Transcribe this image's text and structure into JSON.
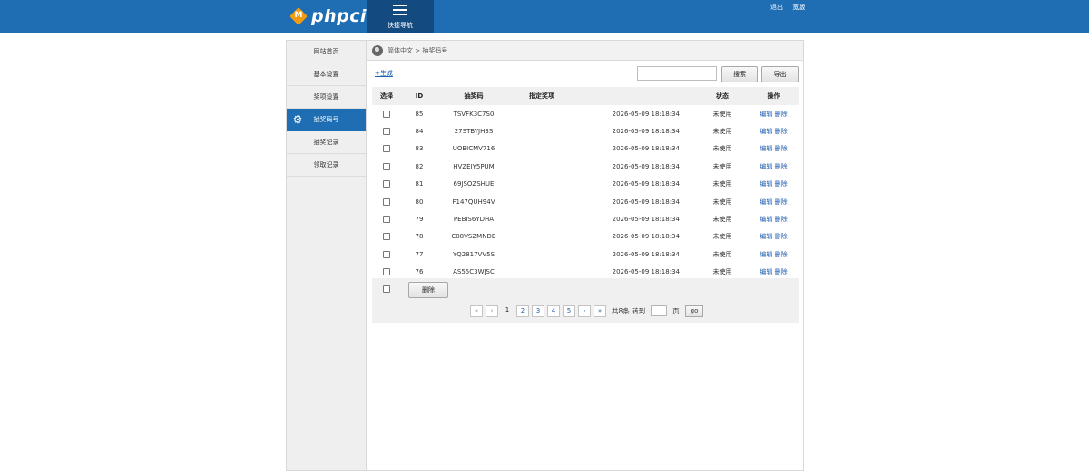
{
  "header": {
    "logo_text": "phpci",
    "logo_mark": "M",
    "quick_nav_label": "快捷导航",
    "links": [
      "退出",
      "宽版"
    ]
  },
  "sidebar": {
    "items": [
      {
        "label": "网站首页",
        "active": false
      },
      {
        "label": "基本设置",
        "active": false
      },
      {
        "label": "奖项设置",
        "active": false
      },
      {
        "label": "抽奖码号",
        "active": true
      },
      {
        "label": "抽奖记录",
        "active": false
      },
      {
        "label": "领取记录",
        "active": false
      }
    ]
  },
  "breadcrumb": "简体中文 > 抽奖码号",
  "toolbar": {
    "generate_link": "+生成",
    "search_value": "",
    "search_button": "搜索",
    "export_button": "导出"
  },
  "table": {
    "headers": [
      "选择",
      "ID",
      "抽奖码",
      "指定奖项",
      "",
      "状态",
      "操作"
    ],
    "rows": [
      {
        "id": "85",
        "code": "TSVFK3C7S0",
        "prize": "",
        "time": "2026-05-09 18:18:34",
        "status": "未使用",
        "edit": "编辑",
        "delete": "删除"
      },
      {
        "id": "84",
        "code": "27STBYJH3S",
        "prize": "",
        "time": "2026-05-09 18:18:34",
        "status": "未使用",
        "edit": "编辑",
        "delete": "删除"
      },
      {
        "id": "83",
        "code": "UOBICMV716",
        "prize": "",
        "time": "2026-05-09 18:18:34",
        "status": "未使用",
        "edit": "编辑",
        "delete": "删除"
      },
      {
        "id": "82",
        "code": "HVZEIY5PUM",
        "prize": "",
        "time": "2026-05-09 18:18:34",
        "status": "未使用",
        "edit": "编辑",
        "delete": "删除"
      },
      {
        "id": "81",
        "code": "69JSOZSHUE",
        "prize": "",
        "time": "2026-05-09 18:18:34",
        "status": "未使用",
        "edit": "编辑",
        "delete": "删除"
      },
      {
        "id": "80",
        "code": "F147QUH94V",
        "prize": "",
        "time": "2026-05-09 18:18:34",
        "status": "未使用",
        "edit": "编辑",
        "delete": "删除"
      },
      {
        "id": "79",
        "code": "PEBIS6YDHA",
        "prize": "",
        "time": "2026-05-09 18:18:34",
        "status": "未使用",
        "edit": "编辑",
        "delete": "删除"
      },
      {
        "id": "78",
        "code": "C08VSZMNDB",
        "prize": "",
        "time": "2026-05-09 18:18:34",
        "status": "未使用",
        "edit": "编辑",
        "delete": "删除"
      },
      {
        "id": "77",
        "code": "YQ2817VV5S",
        "prize": "",
        "time": "2026-05-09 18:18:34",
        "status": "未使用",
        "edit": "编辑",
        "delete": "删除"
      },
      {
        "id": "76",
        "code": "AS55C3WJSC",
        "prize": "",
        "time": "2026-05-09 18:18:34",
        "status": "未使用",
        "edit": "编辑",
        "delete": "删除"
      }
    ],
    "bulk_delete_button": "删除"
  },
  "pagination": {
    "first": "«",
    "prev": "‹",
    "current": "1",
    "pages": [
      "2",
      "3",
      "4",
      "5"
    ],
    "next": "›",
    "last": "»",
    "total_text": "共8条 转到",
    "page_unit": "页",
    "jump_value": "",
    "go_button": "go"
  },
  "colors": {
    "primary": "#1f6db3",
    "primary_dark": "#134a7f",
    "link": "#1f5fb0",
    "logo_accent": "#f39c12"
  }
}
